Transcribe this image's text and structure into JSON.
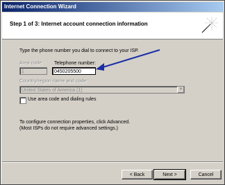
{
  "window": {
    "title": "Internet Connection Wizard"
  },
  "header": {
    "title": "Step 1 of 3: Internet account connection information"
  },
  "instruction": "Type the phone number you dial to connect to your ISP.",
  "area_code": {
    "label": "Area code:",
    "value": "1"
  },
  "telephone": {
    "label": "Telephone number:",
    "value": "0450205500"
  },
  "country": {
    "label": "Country/region name and code:",
    "selected": "United States of America (1)"
  },
  "use_area_code": {
    "label": "Use area code and dialing rules",
    "checked": false
  },
  "advanced_info": {
    "line1": "To configure connection properties, click Advanced.",
    "line2": "(Most ISPs do not require advanced settings.)"
  },
  "buttons": {
    "back": "< Back",
    "next": "Next >",
    "cancel": "Cancel"
  },
  "annotation": {
    "arrow_color": "#1a2fa6"
  }
}
